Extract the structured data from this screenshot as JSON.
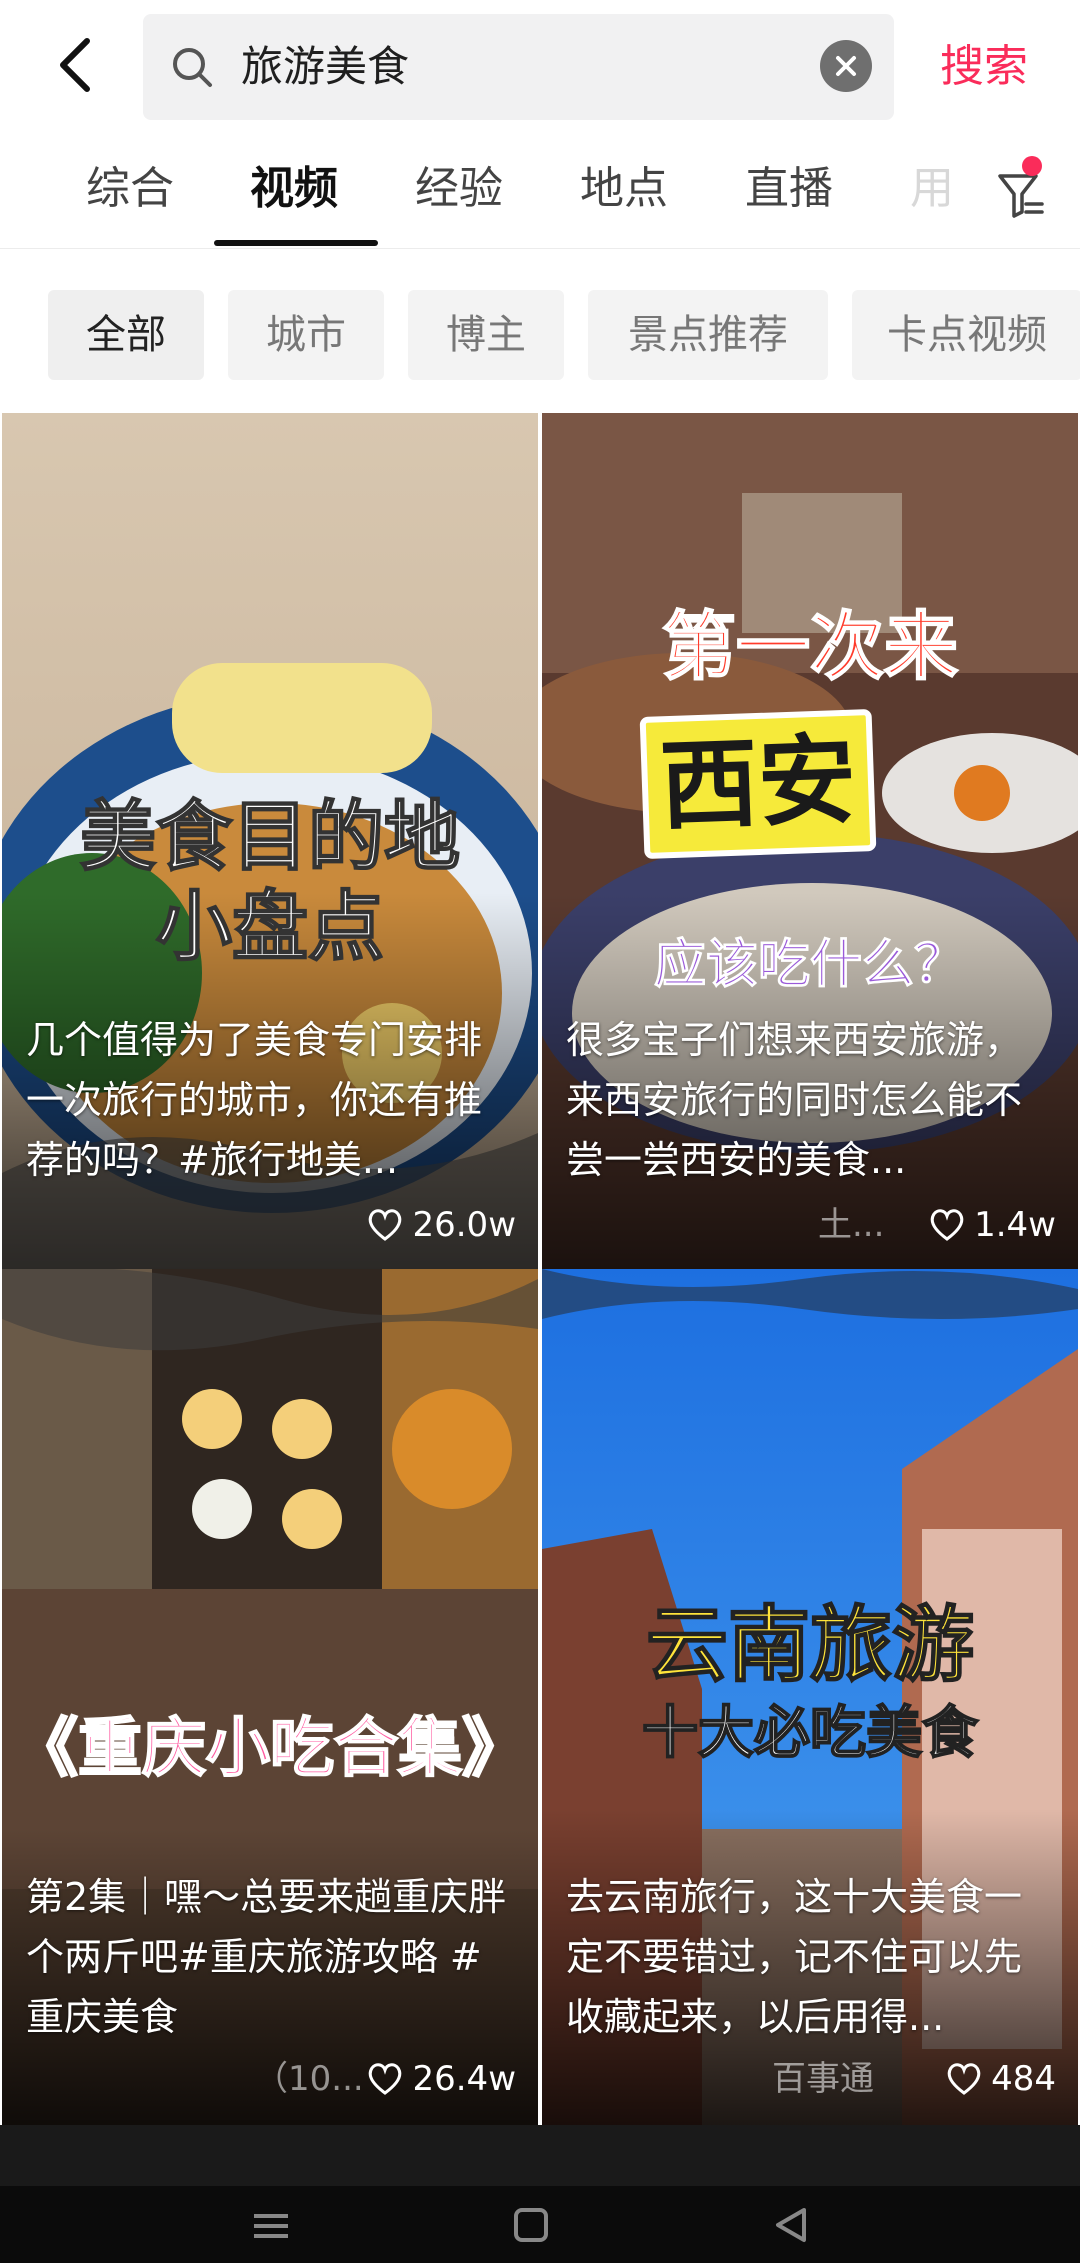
{
  "search": {
    "query": "旅游美食",
    "button_label": "搜索"
  },
  "tabs": [
    {
      "label": "综合"
    },
    {
      "label": "视频"
    },
    {
      "label": "经验"
    },
    {
      "label": "地点"
    },
    {
      "label": "直播"
    },
    {
      "label": "用"
    }
  ],
  "chips": [
    {
      "label": "全部"
    },
    {
      "label": "城市"
    },
    {
      "label": "博主"
    },
    {
      "label": "景点推荐"
    },
    {
      "label": "卡点视频"
    }
  ],
  "cards": [
    {
      "overlay_line1": "美食目的地",
      "overlay_line2": "小盘点",
      "description": "几个值得为了美食专门安排一次旅行的城市，你还有推荐的吗？#旅行地美...",
      "likes": "26.0w"
    },
    {
      "overlay_line1": "第一次来",
      "overlay_line2": "西安",
      "overlay_line3": "应该吃什么？",
      "description": "很多宝子们想来西安旅游，来西安旅行的同时怎么能不尝一尝西安的美食...",
      "author": "土...",
      "likes": "1.4w"
    },
    {
      "overlay_line1": "《重庆小吃合集》",
      "description": "第2集｜嘿～总要来趟重庆胖个两斤吧#重庆旅游攻略 #重庆美食",
      "author": "（10...",
      "likes": "26.4w"
    },
    {
      "overlay_line1": "云南旅游",
      "overlay_line2": "十大必吃美食",
      "description": "去云南旅行，这十大美食一定不要错过，记不住可以先收藏起来，以后用得...",
      "author": "百事通",
      "likes": "484"
    }
  ],
  "colors": {
    "accent": "#fa2c5a",
    "active_tab": "#111111",
    "chip_bg": "#f3f3f3"
  }
}
